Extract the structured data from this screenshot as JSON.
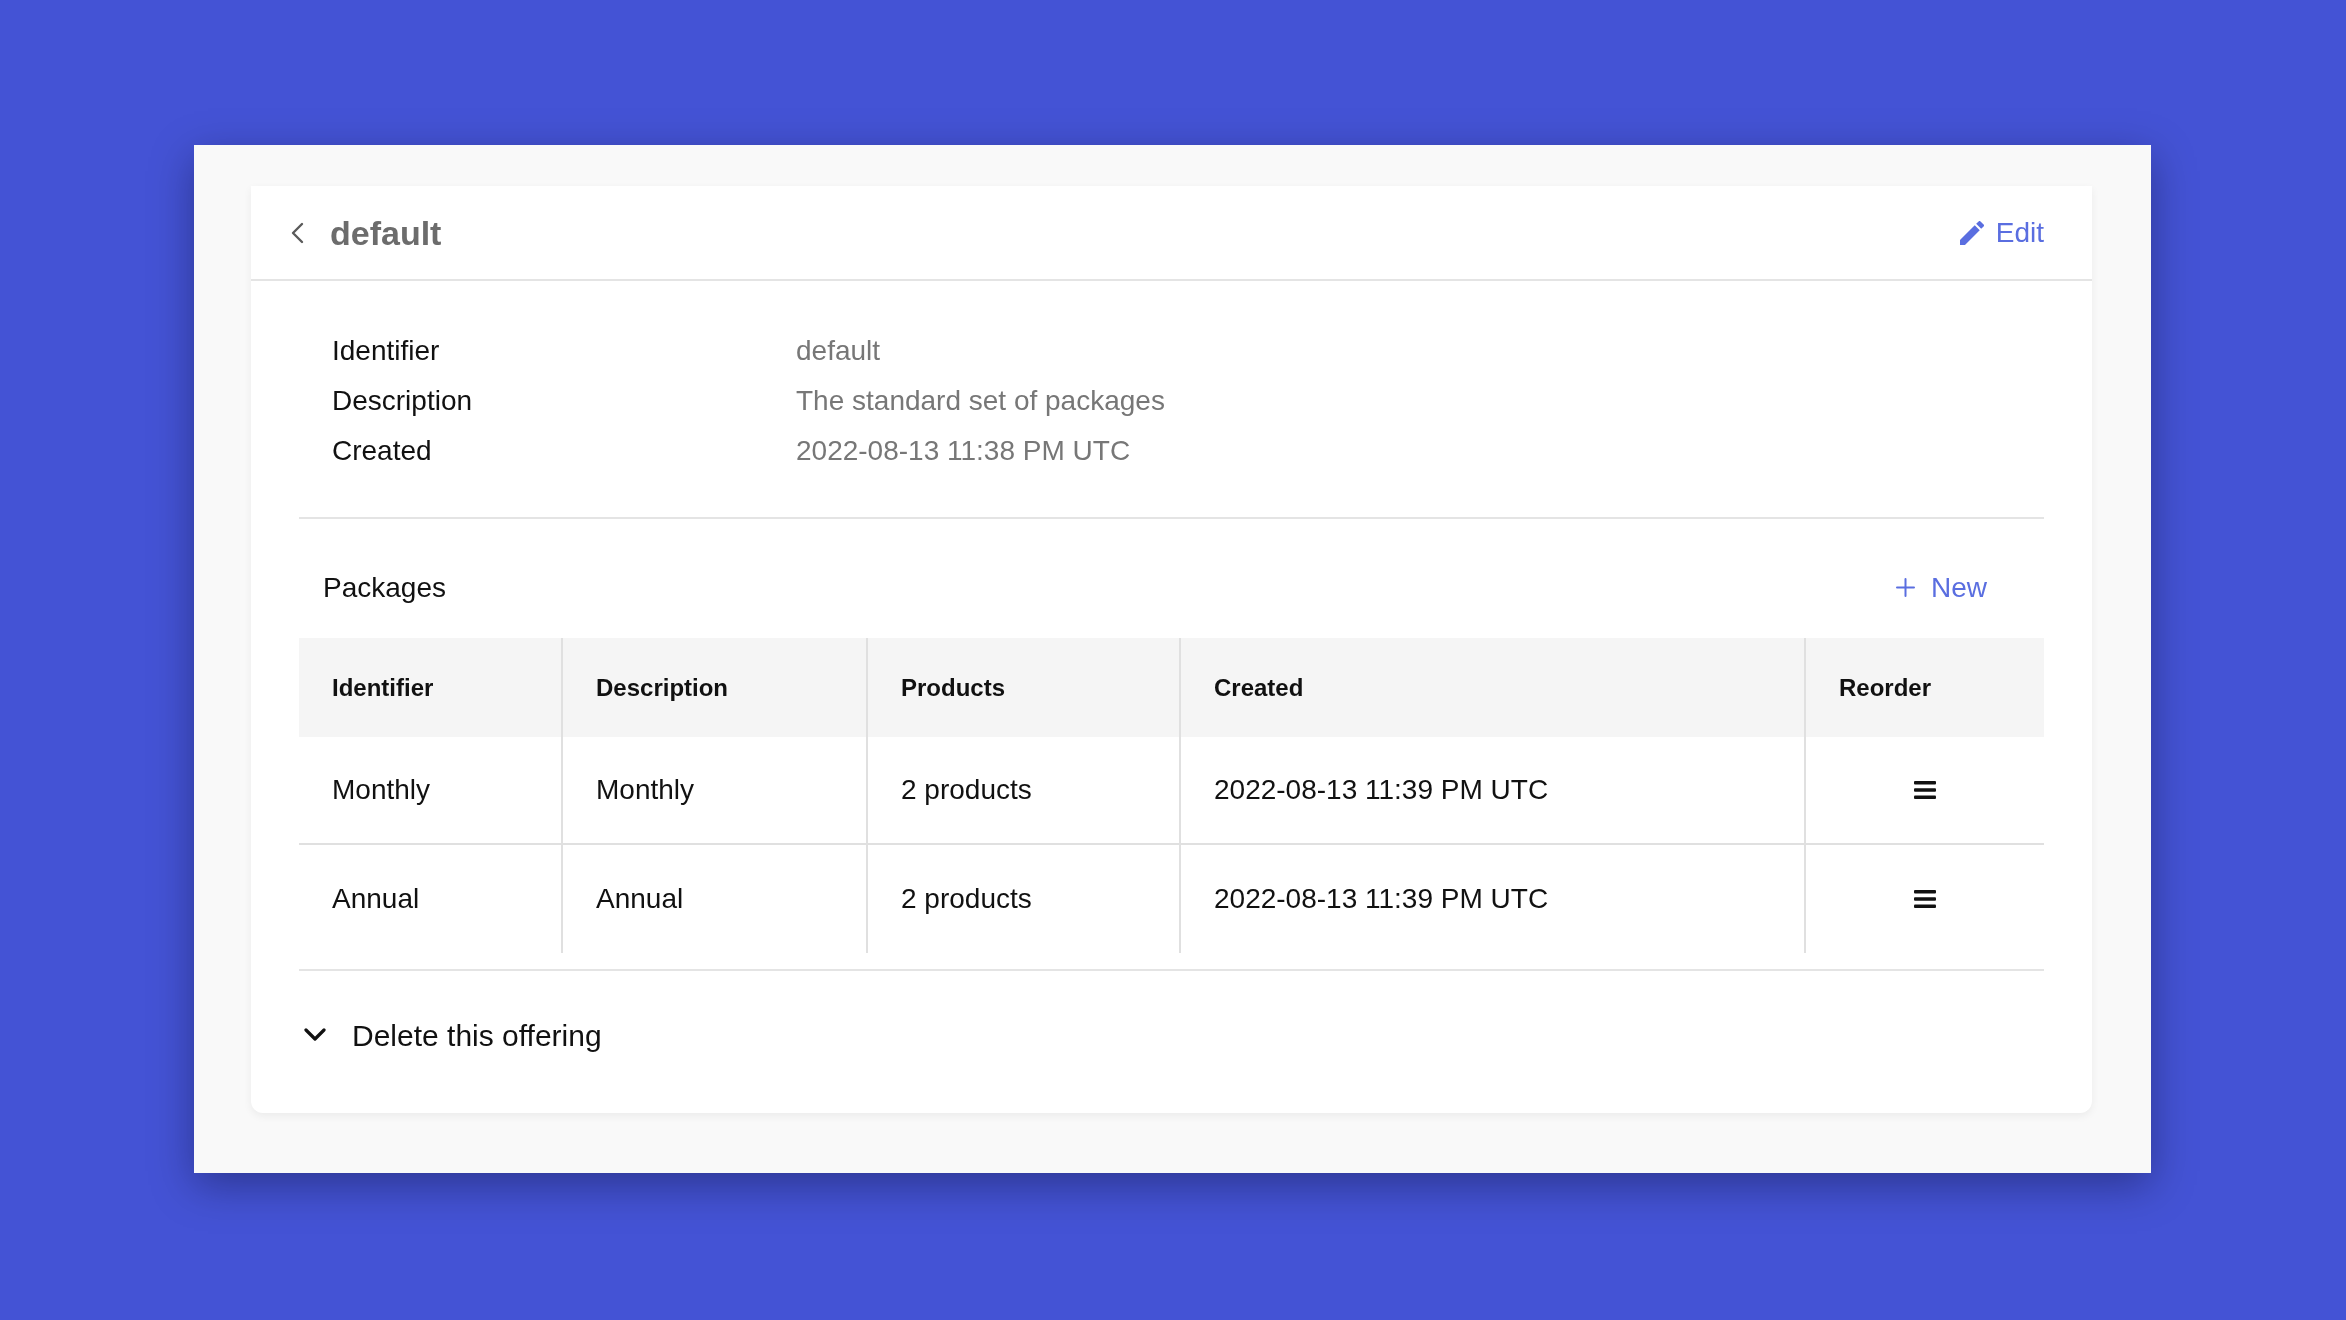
{
  "header": {
    "title": "default",
    "edit_label": "Edit"
  },
  "details": [
    {
      "label": "Identifier",
      "value": "default"
    },
    {
      "label": "Description",
      "value": "The standard set of packages"
    },
    {
      "label": "Created",
      "value": "2022-08-13 11:38 PM UTC"
    }
  ],
  "packages": {
    "title": "Packages",
    "new_label": "New",
    "table": {
      "columns": [
        "Identifier",
        "Description",
        "Products",
        "Created",
        "Reorder"
      ],
      "rows": [
        {
          "cells": [
            "Monthly",
            "Monthly",
            "2 products",
            "2022-08-13 11:39 PM UTC"
          ]
        },
        {
          "cells": [
            "Annual",
            "Annual",
            "2 products",
            "2022-08-13 11:39 PM UTC"
          ]
        }
      ]
    }
  },
  "delete_section": {
    "label": "Delete this offering",
    "expanded": false
  }
}
